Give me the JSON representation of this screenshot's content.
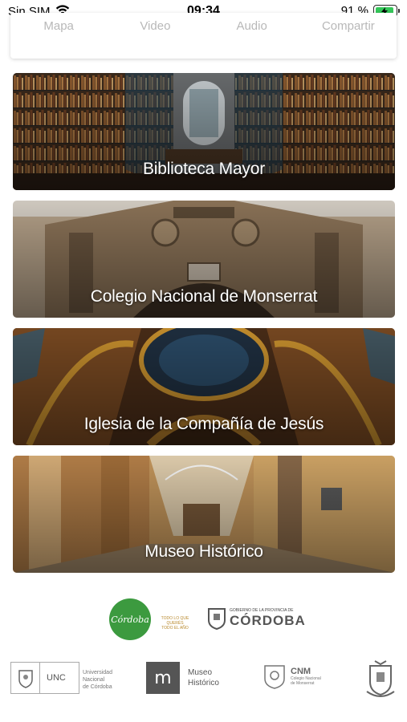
{
  "status_bar": {
    "carrier": "Sin SIM",
    "time": "09:34",
    "battery_percent": "91 %",
    "battery_level": 0.91,
    "battery_color": "#34c759"
  },
  "action_tabs": [
    "Mapa",
    "Video",
    "Audio",
    "Compartir"
  ],
  "places": [
    {
      "title": "Biblioteca Mayor"
    },
    {
      "title": "Colegio Nacional de Monserrat"
    },
    {
      "title": "Iglesia de la Compañía de Jesús"
    },
    {
      "title": "Museo Histórico"
    }
  ],
  "logos": {
    "cordoba_badge": "Córdoba",
    "cordoba_tagline_1": "TODO LO QUE QUERÉS",
    "cordoba_tagline_2": "TODO EL AÑO",
    "gov_small_1": "GOBIERNO DE LA PROVINCIA DE",
    "gov_big": "CÓRDOBA",
    "unc_code": "UNC",
    "unc_name_1": "Universidad",
    "unc_name_2": "Nacional",
    "unc_name_3": "de Córdoba",
    "museo_mark": "m",
    "museo_1": "Museo",
    "museo_2": "Histórico",
    "cnm_code": "CNM",
    "cnm_1": "Colegio Nacional",
    "cnm_2": "de Monserrat"
  },
  "icons": {
    "wifi": "wifi-icon",
    "battery": "battery-charging-icon"
  }
}
